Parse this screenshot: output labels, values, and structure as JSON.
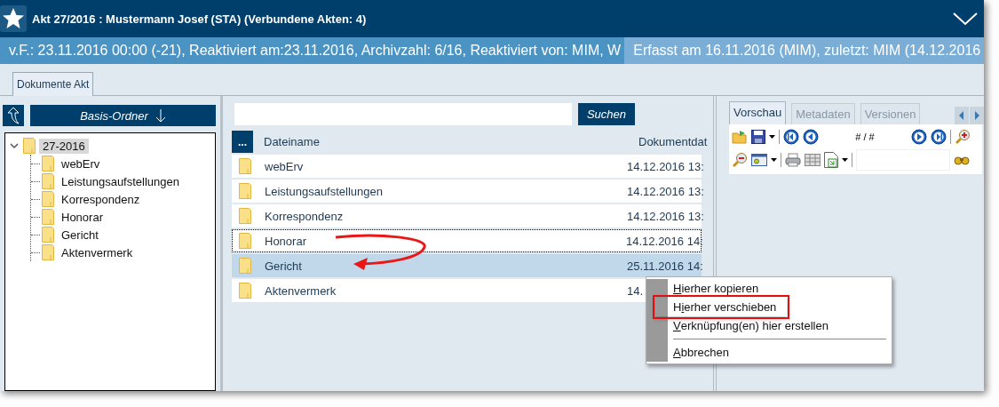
{
  "window": {
    "title": "Akt 27/2016 : Mustermann Josef (STA) (Verbundene Akten: 4)"
  },
  "info_bar": {
    "details": "v.F.: 23.11.2016 00:00 (-21), Reaktiviert am:23.11.2016, Archivzahl: 6/16, Reaktiviert von: MIM, W",
    "created": "Erfasst am 16.11.2016 (MIM), zuletzt: MIM (14.12.2016"
  },
  "tabs": [
    {
      "label": "Dokumente Akt",
      "selected": true
    }
  ],
  "folder_panel": {
    "base_button": "Basis-Ordner",
    "tree": [
      {
        "label": "27-2016",
        "expanded": true,
        "selected": true,
        "children": [
          {
            "label": "webErv",
            "selected": false
          },
          {
            "label": "Leistungsaufstellungen",
            "selected": false
          },
          {
            "label": "Korrespondenz",
            "selected": false
          },
          {
            "label": "Honorar",
            "selected": false
          },
          {
            "label": "Gericht",
            "selected": false
          },
          {
            "label": "Aktenvermerk",
            "selected": false
          }
        ]
      }
    ]
  },
  "file_list": {
    "search_button": "Suchen",
    "menu_button": "...",
    "columns": [
      "Dateiname",
      "Dokumentdat"
    ],
    "rows": [
      {
        "name": "webErv",
        "date": "14.12.2016 13:",
        "selected": false,
        "focused": false
      },
      {
        "name": "Leistungsaufstellungen",
        "date": "14.12.2016 13:",
        "selected": false,
        "focused": false
      },
      {
        "name": "Korrespondenz",
        "date": "14.12.2016 13:",
        "selected": false,
        "focused": false
      },
      {
        "name": "Honorar",
        "date": "14.12.2016 14:",
        "selected": false,
        "focused": true
      },
      {
        "name": "Gericht",
        "date": "25.11.2016 14:",
        "selected": true,
        "focused": false
      },
      {
        "name": "Aktenvermerk",
        "date": "14.",
        "selected": false,
        "focused": false
      }
    ]
  },
  "preview": {
    "tabs": [
      {
        "label": "Vorschau",
        "selected": true
      },
      {
        "label": "Metadaten",
        "selected": false
      },
      {
        "label": "Versionen",
        "selected": false
      }
    ],
    "page_counter": "# / #"
  },
  "context_menu": {
    "items": [
      {
        "kind": "item",
        "key": "H",
        "post": "ierher kopieren",
        "highlighted": false
      },
      {
        "kind": "item",
        "pre": "H",
        "key": "i",
        "post": "erher verschieben",
        "highlighted": true
      },
      {
        "kind": "item",
        "key": "V",
        "post": "erknüpfung(en) hier erstellen",
        "highlighted": false
      },
      {
        "kind": "separator"
      },
      {
        "kind": "item",
        "key": "A",
        "post": "bbrechen",
        "highlighted": false
      }
    ]
  }
}
